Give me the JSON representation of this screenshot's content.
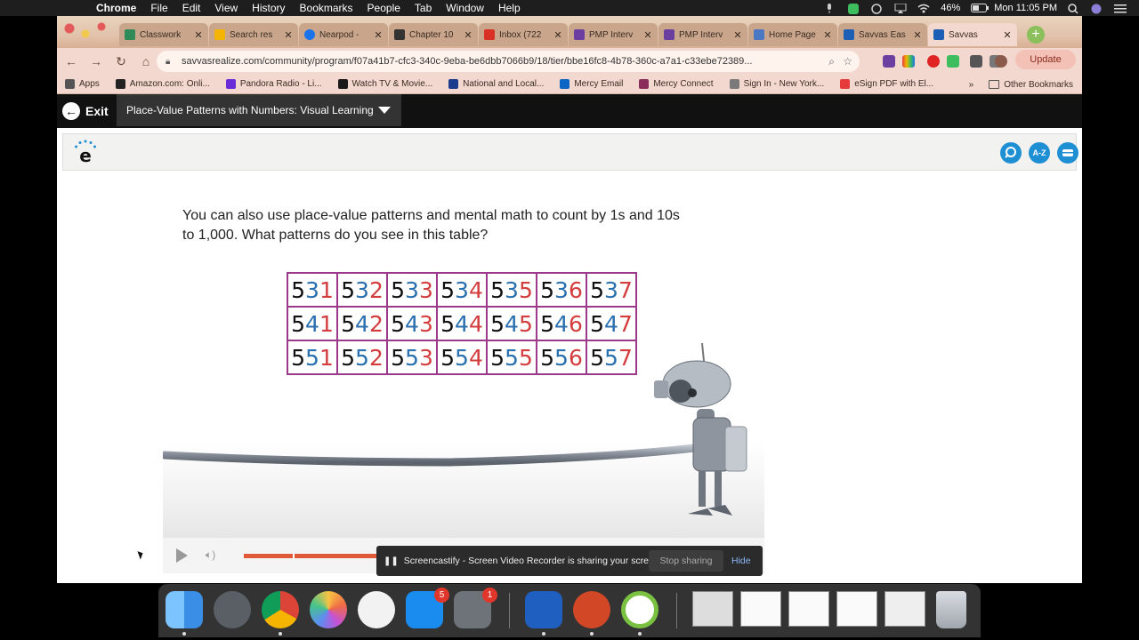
{
  "menubar": {
    "app": "Chrome",
    "items": [
      "File",
      "Edit",
      "View",
      "History",
      "Bookmarks",
      "People",
      "Tab",
      "Window",
      "Help"
    ],
    "battery": "46%",
    "clock": "Mon 11:05 PM"
  },
  "tabs": [
    {
      "label": "Classwork",
      "color": "#2e8b57"
    },
    {
      "label": "Search res",
      "color": "#f4b400"
    },
    {
      "label": "Nearpod - ",
      "color": "#1a73e8"
    },
    {
      "label": "Chapter 10",
      "color": "#333333"
    },
    {
      "label": "Inbox (722",
      "color": "#d93025"
    },
    {
      "label": "PMP Interv",
      "color": "#6a3fa0"
    },
    {
      "label": "PMP Interv",
      "color": "#6a3fa0"
    },
    {
      "label": "Home Page",
      "color": "#4a78c2"
    },
    {
      "label": "Savvas Eas",
      "color": "#1d5fb4"
    },
    {
      "label": "Savvas",
      "color": "#1d5fb4"
    }
  ],
  "toolbar": {
    "url": "savvasrealize.com/community/program/f07a41b7-cfc3-340c-9eba-be6dbb7066b9/18/tier/bbe16fc8-4b78-360c-a7a1-c33ebe72389...",
    "update_label": "Update"
  },
  "bookmarks": {
    "items": [
      {
        "label": "Apps",
        "color": "#555555"
      },
      {
        "label": "Amazon.com: Onli...",
        "color": "#222222"
      },
      {
        "label": "Pandora Radio - Li...",
        "color": "#6b2bd6"
      },
      {
        "label": "Watch TV & Movie...",
        "color": "#1a1a1a"
      },
      {
        "label": "National and Local...",
        "color": "#1b3c8c"
      },
      {
        "label": "Mercy Email",
        "color": "#0a66c2"
      },
      {
        "label": "Mercy Connect",
        "color": "#8a2c5c"
      },
      {
        "label": "Sign In - New York...",
        "color": "#7a7a7a"
      },
      {
        "label": "eSign PDF with El...",
        "color": "#e53b3b"
      }
    ],
    "more": "»",
    "other": "Other Bookmarks"
  },
  "appbar": {
    "exit_label": "Exit",
    "lesson_title": "Place-Value Patterns with Numbers: Visual Learning"
  },
  "tools": {
    "logo_letter": "e",
    "icon_glossary": "A-Z"
  },
  "content": {
    "prompt_line1": "You can also use place-value patterns and mental math to count by 1s and 10s",
    "prompt_line2": "to 1,000. What patterns do you see in this table?"
  },
  "number_table": [
    [
      531,
      532,
      533,
      534,
      535,
      536,
      537
    ],
    [
      541,
      542,
      543,
      544,
      545,
      546,
      547
    ],
    [
      551,
      552,
      553,
      554,
      555,
      556,
      557
    ]
  ],
  "video": {
    "progress": 0.27
  },
  "share_bar": {
    "message": "Screencastify - Screen Video Recorder is sharing your screen.",
    "stop_label": "Stop sharing",
    "hide_label": "Hide"
  },
  "dock": {
    "appstore_badge": "5",
    "settings_badge": "1"
  }
}
